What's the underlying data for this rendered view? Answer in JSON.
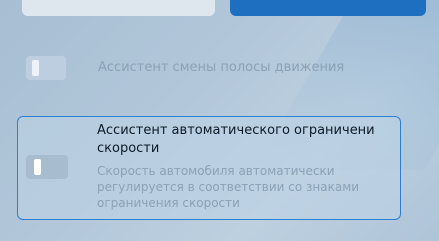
{
  "settings": {
    "lane_assist": {
      "label": "Ассистент смены полосы движения",
      "enabled": false
    },
    "speed_limit_assist": {
      "title": "Ассистент автоматического ограничени скорости",
      "description": "Скорость автомобиля автоматически регулируется в соответствии со знаками ограничения скорости",
      "enabled": false
    }
  },
  "colors": {
    "accent": "#1f6fc0",
    "focus_border": "#2f7fd0",
    "muted_text": "#8ba1b5",
    "primary_text": "#0c1a26"
  }
}
